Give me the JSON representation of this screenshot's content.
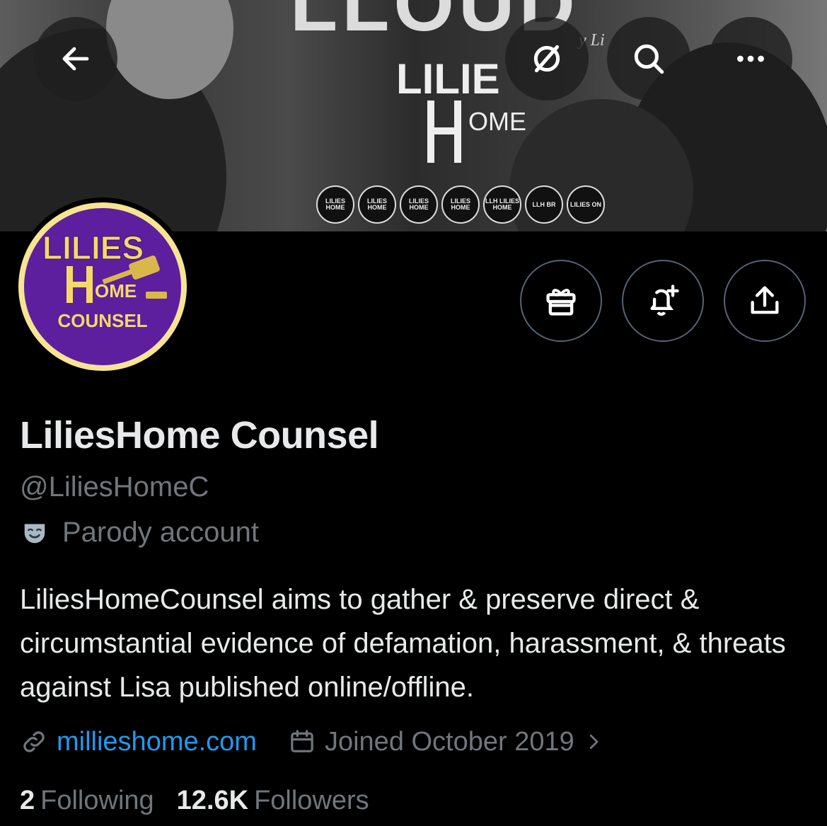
{
  "banner": {
    "title_fragment": "LLOUD",
    "small_text": "y Li",
    "logo_text_top": "LILIES",
    "logo_text_bottom": "OME",
    "badges": [
      "LILIES HOME",
      "LILIES HOME",
      "LILIES HOME",
      "LILIES HOME",
      "LLH LILIES HOME",
      "LLH BR",
      "LILIES ON"
    ]
  },
  "nav": {
    "back_icon": "arrow-left-icon",
    "nofollow_icon": "circle-slash-icon",
    "search_icon": "search-icon",
    "more_icon": "ellipsis-icon"
  },
  "avatar": {
    "line1": "LILIES",
    "line2": "OME",
    "line3": "COUNSEL"
  },
  "actions": {
    "gift_icon": "gift-icon",
    "notify_icon": "bell-plus-icon",
    "share_icon": "share-icon"
  },
  "profile": {
    "display_name": "LiliesHome Counsel",
    "handle": "@LiliesHomeC",
    "parody_label": "Parody account",
    "parody_icon": "theater-mask-icon",
    "bio": "LiliesHomeCounsel aims to gather & preserve direct & circumstantial evidence of defamation, harassment, & threats against Lisa published online/offline.",
    "website": "millieshome.com",
    "joined": "Joined October 2019"
  },
  "stats": {
    "following_count": "2",
    "following_label": "Following",
    "followers_count": "12.6K",
    "followers_label": "Followers"
  },
  "colors": {
    "background": "#000000",
    "text_primary": "#e7e9ea",
    "text_secondary": "#71767b",
    "link": "#1d9bf0",
    "avatar_purple": "#5d1f9d",
    "avatar_gold": "#f7e493"
  }
}
